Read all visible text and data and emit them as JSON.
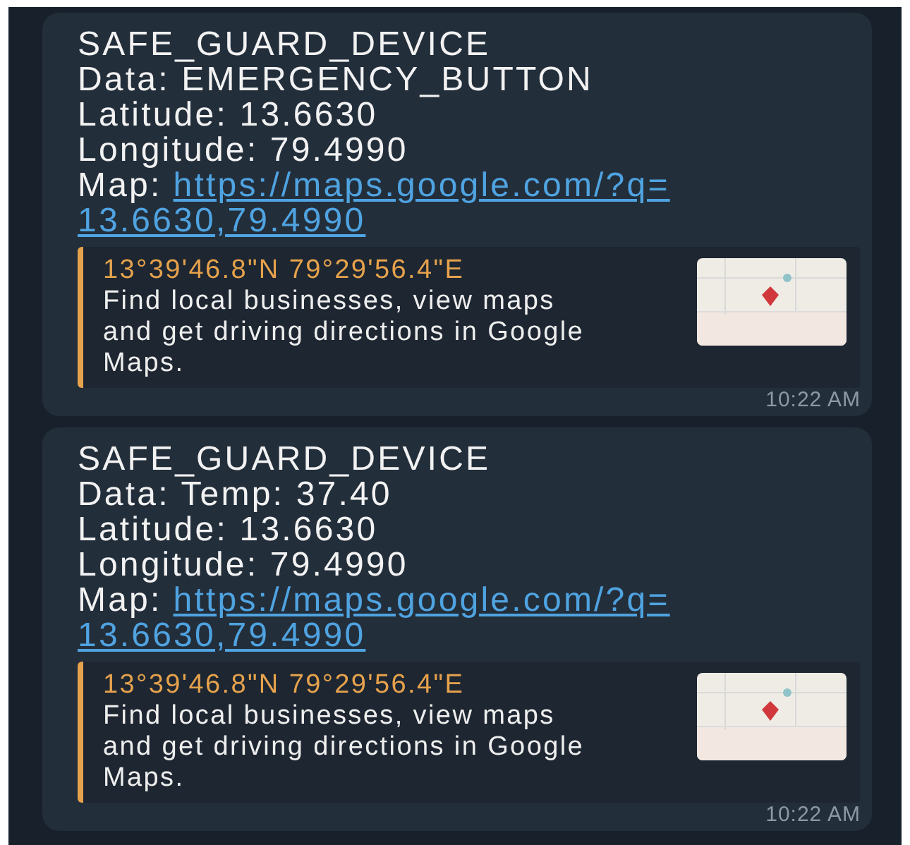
{
  "messages": [
    {
      "sender": "SAFE_GUARD_DEVICE",
      "data": "Data: EMERGENCY_BUTTON",
      "latitude": "Latitude: 13.6630",
      "longitude": "Longitude: 79.4990",
      "map_label": "Map:",
      "map_url": "https://maps.google.com/?q=13.6630,79.4990",
      "preview": {
        "title": "13°39'46.8\"N 79°29'56.4\"E",
        "description": "Find local businesses, view maps and get driving directions in Google Maps.",
        "kind": "picture"
      },
      "time": "10:22 AM"
    },
    {
      "sender": "SAFE_GUARD_DEVICE",
      "data": "Data: Temp: 37.40",
      "latitude": "Latitude: 13.6630",
      "longitude": "Longitude: 79.4990",
      "map_label": "Map:",
      "map_url": "https://maps.google.com/?q=13.6630,79.4990",
      "preview": {
        "title": "13°39'46.8\"N 79°29'56.4\"E",
        "description": "Find local businesses, view maps and get driving directions in Google Maps.",
        "kind": "picture"
      },
      "time": "10:22 AM"
    }
  ]
}
